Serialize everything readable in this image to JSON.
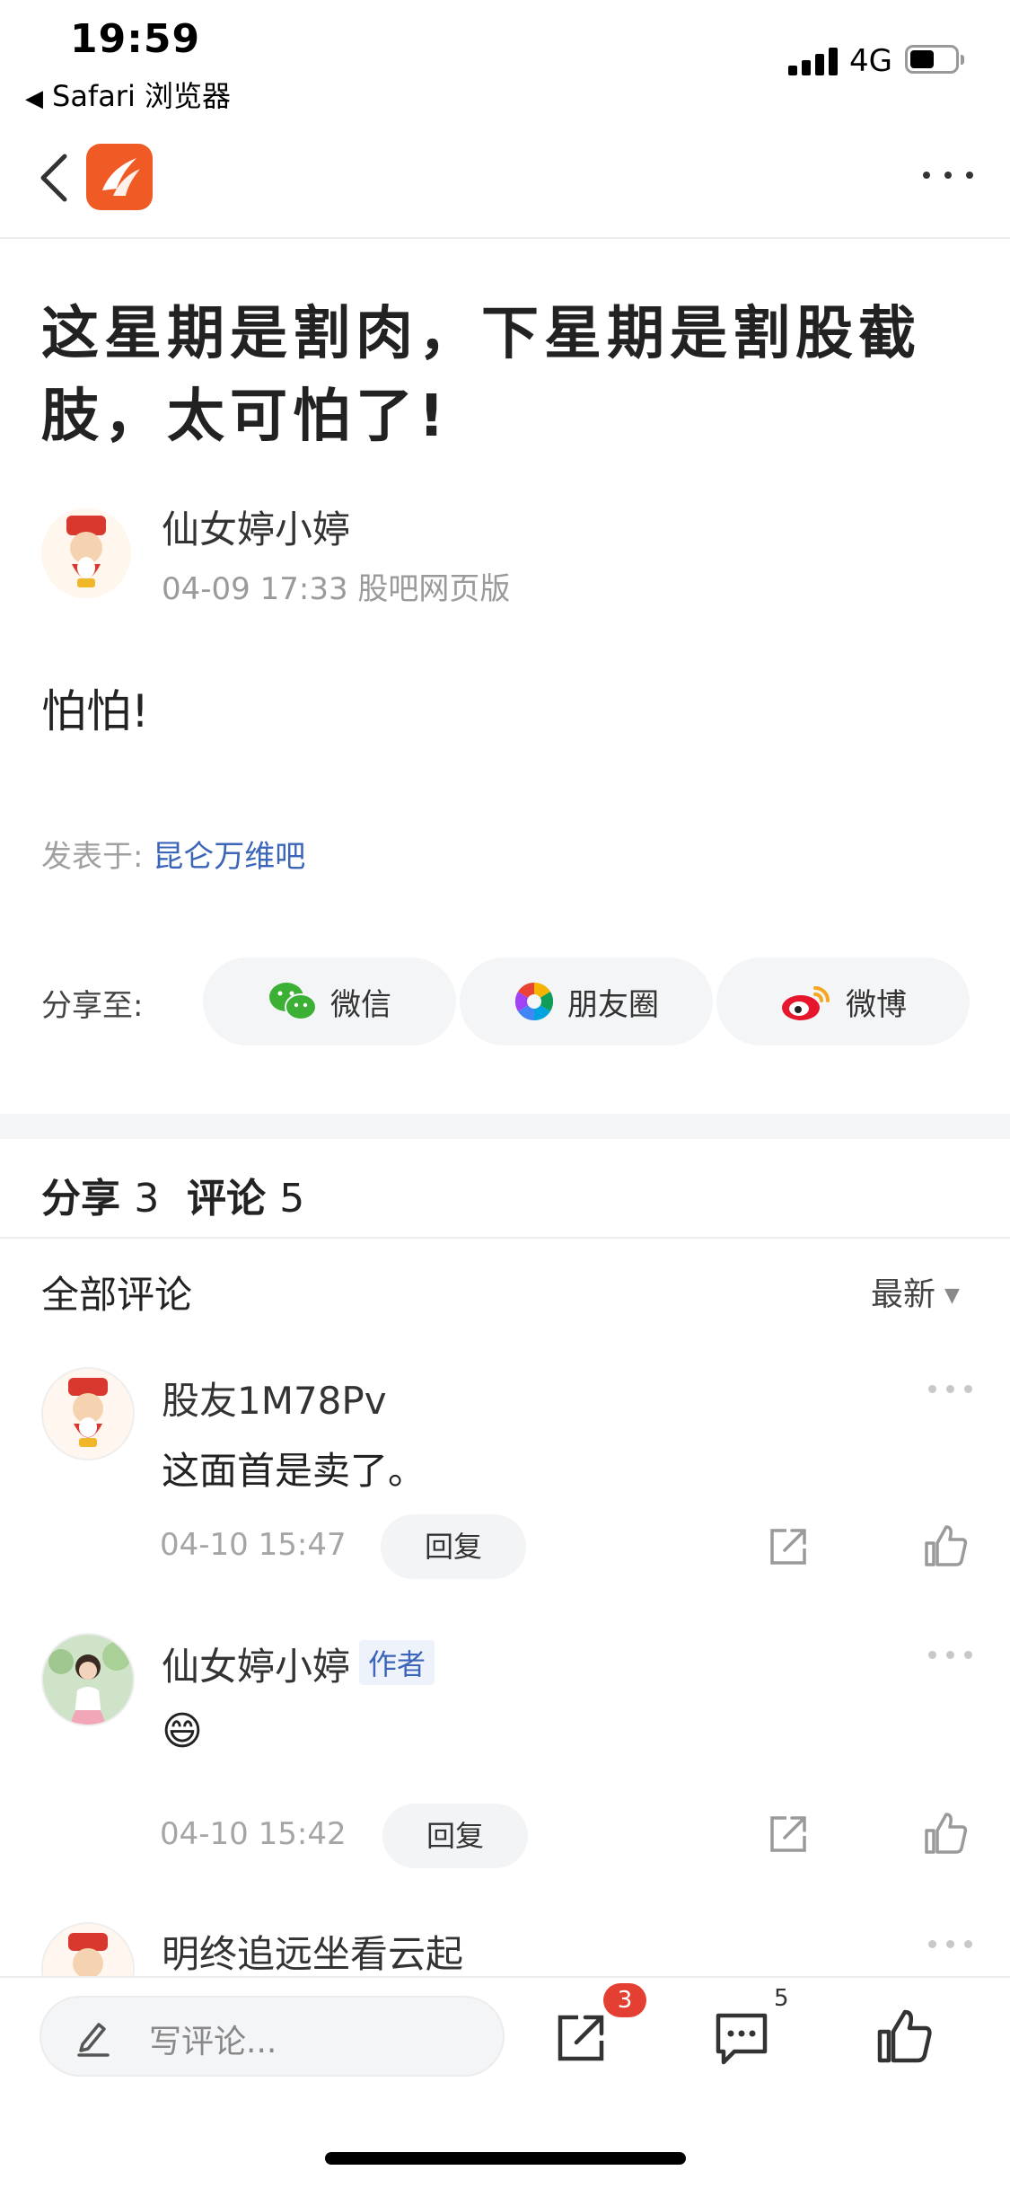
{
  "status_bar": {
    "time": "19:59",
    "back_app": "Safari 浏览器",
    "network": "4G"
  },
  "post": {
    "title": "这星期是割肉，下星期是割股截肢，太可怕了!",
    "author": "仙女婷小婷",
    "meta": "04-09 17:33 股吧网页版",
    "body": "怕怕!",
    "posted_in_label": "发表于:",
    "posted_in_bar": "昆仑万维吧"
  },
  "share": {
    "label": "分享至:",
    "targets": [
      {
        "label": "微信",
        "icon": "wechat-icon"
      },
      {
        "label": "朋友圈",
        "icon": "moments-icon"
      },
      {
        "label": "微博",
        "icon": "weibo-icon"
      }
    ]
  },
  "counts": {
    "share_label": "分享",
    "share_count": "3",
    "comment_label": "评论",
    "comment_count": "5"
  },
  "comments_header": {
    "title": "全部评论",
    "sort": "最新"
  },
  "comments": [
    {
      "name": "股友1M78Pv",
      "text": "这面首是卖了。",
      "time": "04-10 15:47",
      "reply": "回复",
      "is_author": false
    },
    {
      "name": "仙女婷小婷",
      "author_tag": "作者",
      "text": "😄",
      "time": "04-10 15:42",
      "reply": "回复",
      "is_author": true
    },
    {
      "name": "明终追远坐看云起"
    }
  ],
  "bottom_bar": {
    "write_placeholder": "写评论...",
    "share_badge": "3",
    "comment_count": "5"
  },
  "colors": {
    "brand": "#f05a24",
    "link": "#3b65b9",
    "badge": "#e34033"
  }
}
